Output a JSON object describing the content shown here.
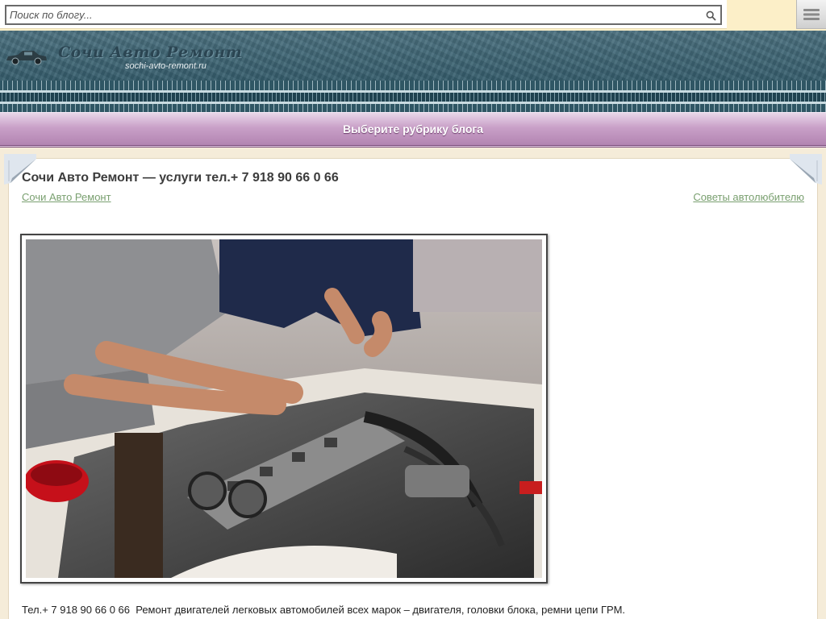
{
  "search": {
    "placeholder": "Поиск по блогу..."
  },
  "site": {
    "title": "Сочи Авто Ремонт",
    "domain": "sochi-avto-remont.ru"
  },
  "categories": {
    "label": "Выберите рубрику блога"
  },
  "post": {
    "title": "Сочи Авто Ремонт — услуги тел.+ 7 918 90 66 0 66",
    "left_link": "Сочи Авто Ремонт",
    "right_link": "Советы автолюбителю",
    "text": "Тел.+ 7 918 90 66 0 66  Ремонт двигателей легковых автомобилей всех марок – двигателя, головки блока, ремни цепи ГРМ."
  },
  "colors": {
    "header": "#3f6a7a",
    "category_bar": "#c9a0c8",
    "link": "#7aa070",
    "page_bg": "#f5ecd9"
  },
  "icons": {
    "search": "magnifier-icon",
    "menu": "hamburger-menu-icon",
    "logo": "car-icon"
  }
}
